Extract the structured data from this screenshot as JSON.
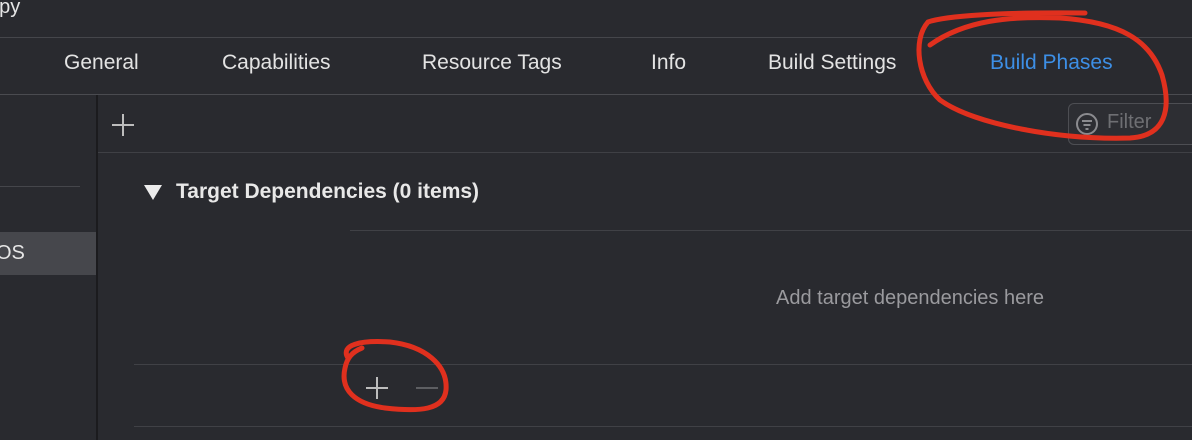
{
  "window": {
    "title": "ppy"
  },
  "tabs": [
    {
      "label": "General"
    },
    {
      "label": "Capabilities"
    },
    {
      "label": "Resource Tags"
    },
    {
      "label": "Info"
    },
    {
      "label": "Build Settings"
    },
    {
      "label": "Build Phases",
      "active": true
    }
  ],
  "sidebar": {
    "selected_item": "OS"
  },
  "toolbar": {
    "add_icon": "plus-icon",
    "filter_icon": "filter-icon",
    "filter_placeholder": "Filter"
  },
  "section": {
    "title": "Target Dependencies (0 items)",
    "empty_text": "Add target dependencies here",
    "add_icon": "plus-icon",
    "remove_icon": "minus-icon"
  },
  "colors": {
    "background": "#292a2f",
    "active_tab": "#3d8fe6",
    "sidebar_selection": "#46474c",
    "annotation": "#e0301e"
  }
}
